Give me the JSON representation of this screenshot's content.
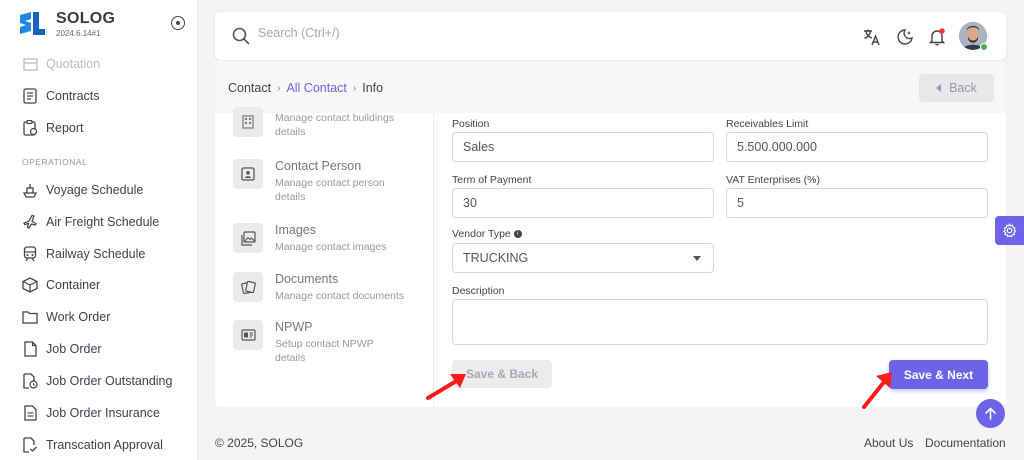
{
  "brand": {
    "name": "SOLOG",
    "version": "2024.6.14#1"
  },
  "sidebar": {
    "items_top": [
      {
        "label": "Quotation",
        "icon": "quotation-icon"
      },
      {
        "label": "Contracts",
        "icon": "contracts-icon"
      },
      {
        "label": "Report",
        "icon": "report-icon"
      }
    ],
    "section_label": "OPERATIONAL",
    "items_operational": [
      {
        "label": "Voyage Schedule",
        "icon": "ship-icon"
      },
      {
        "label": "Air Freight Schedule",
        "icon": "plane-icon"
      },
      {
        "label": "Railway Schedule",
        "icon": "train-icon"
      },
      {
        "label": "Container",
        "icon": "container-icon"
      },
      {
        "label": "Work Order",
        "icon": "folder-icon"
      },
      {
        "label": "Job Order",
        "icon": "document-icon"
      },
      {
        "label": "Job Order Outstanding",
        "icon": "document-clock-icon"
      },
      {
        "label": "Job Order Insurance",
        "icon": "document-list-icon"
      },
      {
        "label": "Transcation Approval",
        "icon": "document-check-icon"
      }
    ]
  },
  "search": {
    "placeholder": "Search (Ctrl+/)"
  },
  "breadcrumb": {
    "root": "Contact",
    "link": "All Contact",
    "current": "Info"
  },
  "back_label": "Back",
  "left_menu": [
    {
      "title": "",
      "desc": "Manage contact buildings details",
      "icon": "building-icon"
    },
    {
      "title": "Contact Person",
      "desc": "Manage contact person details",
      "icon": "contact-person-icon"
    },
    {
      "title": "Images",
      "desc": "Manage contact images",
      "icon": "images-icon"
    },
    {
      "title": "Documents",
      "desc": "Manage contact documents",
      "icon": "documents-icon"
    },
    {
      "title": "NPWP",
      "desc": "Setup contact NPWP details",
      "icon": "npwp-card-icon"
    }
  ],
  "form": {
    "position": {
      "label": "Position",
      "value": "Sales"
    },
    "receivables_limit": {
      "label": "Receivables Limit",
      "value": "5.500.000.000"
    },
    "term_of_payment": {
      "label": "Term of Payment",
      "value": "30"
    },
    "vat_enterprises": {
      "label": "VAT Enterprises (%)",
      "value": "5"
    },
    "vendor_type": {
      "label": "Vendor Type",
      "value": "TRUCKING"
    },
    "description": {
      "label": "Description",
      "value": ""
    }
  },
  "buttons": {
    "save_back": "Save & Back",
    "save_next": "Save & Next"
  },
  "footer": {
    "copyright": "© 2025, SOLOG",
    "about": "About Us",
    "docs": "Documentation"
  },
  "colors": {
    "accent": "#6c63e8",
    "annotation_arrow": "#ff1a1a"
  }
}
